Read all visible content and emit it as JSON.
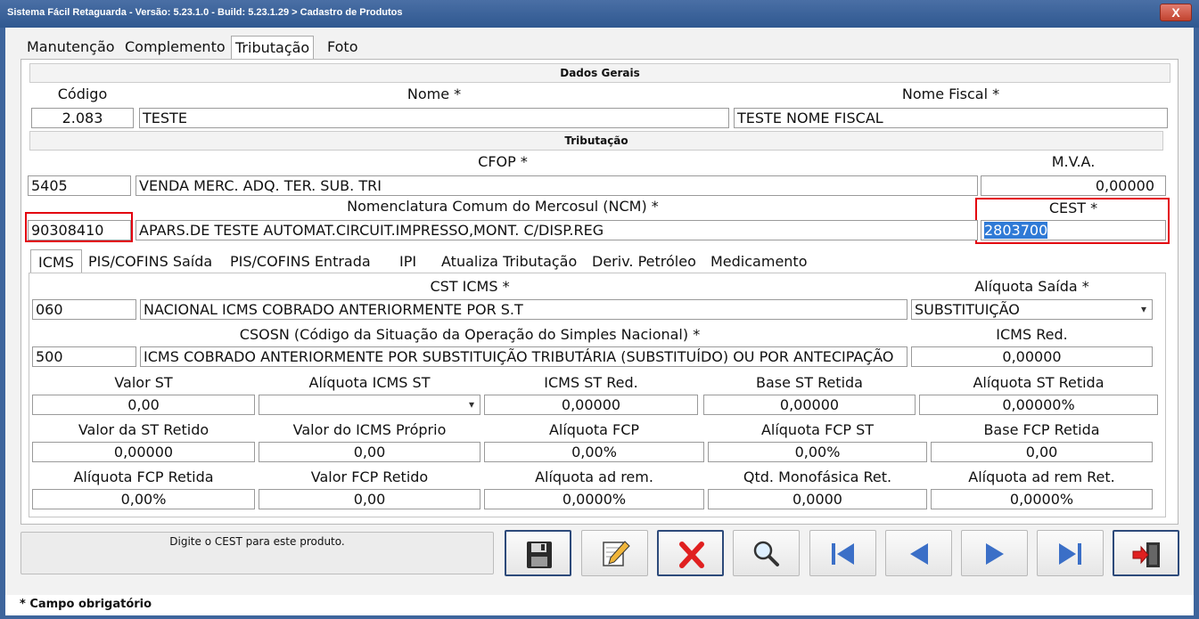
{
  "window": {
    "title": "Sistema Fácil Retaguarda - Versão: 5.23.1.0  - Build: 5.23.1.29 > Cadastro de Produtos",
    "close_label": "X"
  },
  "tabs": [
    {
      "label": "Manutenção",
      "active": false
    },
    {
      "label": "Complemento",
      "active": false
    },
    {
      "label": "Tributação",
      "active": true
    },
    {
      "label": "Foto",
      "active": false
    }
  ],
  "dados_gerais": {
    "header": "Dados Gerais",
    "codigo_label": "Código",
    "codigo_value": "2.083",
    "nome_label": "Nome *",
    "nome_value": "TESTE",
    "nome_fiscal_label": "Nome Fiscal *",
    "nome_fiscal_value": "TESTE NOME FISCAL"
  },
  "tributacao": {
    "header": "Tributação",
    "cfop_label": "CFOP *",
    "cfop_code": "5405",
    "cfop_desc": "VENDA MERC. ADQ. TER. SUB. TRI",
    "mva_label": "M.V.A.",
    "mva_value": "0,00000",
    "ncm_label": "Nomenclatura Comum do Mercosul (NCM) *",
    "ncm_code": "90308410",
    "ncm_desc": "APARS.DE TESTE AUTOMAT.CIRCUIT.IMPRESSO,MONT. C/DISP.REG",
    "cest_label": "CEST *",
    "cest_value": "2803700"
  },
  "subtabs": [
    {
      "label": "ICMS",
      "active": true
    },
    {
      "label": "PIS/COFINS Saída",
      "active": false
    },
    {
      "label": "PIS/COFINS Entrada",
      "active": false
    },
    {
      "label": "IPI",
      "active": false
    },
    {
      "label": "Atualiza Tributação",
      "active": false
    },
    {
      "label": "Deriv. Petróleo",
      "active": false
    },
    {
      "label": "Medicamento",
      "active": false
    }
  ],
  "icms": {
    "cst_label": "CST ICMS *",
    "cst_code": "060",
    "cst_desc": "NACIONAL ICMS COBRADO ANTERIORMENTE POR S.T",
    "aliq_saida_label": "Alíquota Saída *",
    "aliq_saida_value": "SUBSTITUIÇÃO",
    "csosn_label": "CSOSN (Código da Situação da Operação do Simples Nacional) *",
    "csosn_code": "500",
    "csosn_desc": "ICMS COBRADO ANTERIORMENTE POR SUBSTITUIÇÃO TRIBUTÁRIA (SUBSTITUÍDO) OU POR ANTECIPAÇÃO",
    "icms_red_label": "ICMS Red.",
    "icms_red_value": "0,00000",
    "row1": [
      {
        "label": "Valor ST",
        "value": "0,00"
      },
      {
        "label": "Alíquota ICMS ST",
        "value": ""
      },
      {
        "label": "ICMS ST Red.",
        "value": "0,00000"
      },
      {
        "label": "Base ST Retida",
        "value": "0,00000"
      },
      {
        "label": "Alíquota ST Retida",
        "value": "0,00000%"
      }
    ],
    "row2": [
      {
        "label": "Valor da ST Retido",
        "value": "0,00000"
      },
      {
        "label": "Valor do ICMS Próprio",
        "value": "0,00"
      },
      {
        "label": "Alíquota FCP",
        "value": "0,00%"
      },
      {
        "label": "Alíquota FCP ST",
        "value": "0,00%"
      },
      {
        "label": "Base FCP Retida",
        "value": "0,00"
      }
    ],
    "row3": [
      {
        "label": "Alíquota FCP Retida",
        "value": "0,00%"
      },
      {
        "label": "Valor FCP Retido",
        "value": "0,00"
      },
      {
        "label": "Alíquota ad rem.",
        "value": "0,0000%"
      },
      {
        "label": "Qtd. Monofásica Ret.",
        "value": "0,0000"
      },
      {
        "label": "Alíquota ad rem Ret.",
        "value": "0,0000%"
      }
    ]
  },
  "status_message": "Digite o CEST para este produto.",
  "toolbar": {
    "buttons": [
      {
        "icon": "floppy-disk-icon"
      },
      {
        "icon": "edit-pencil-icon"
      },
      {
        "icon": "delete-x-icon"
      },
      {
        "icon": "search-magnifier-icon"
      },
      {
        "icon": "first-record-icon"
      },
      {
        "icon": "previous-record-icon"
      },
      {
        "icon": "next-record-icon"
      },
      {
        "icon": "last-record-icon"
      },
      {
        "icon": "exit-door-icon"
      }
    ]
  },
  "footer": {
    "text": "*  Campo obrigatório"
  },
  "colors": {
    "titlebar": "#2f5890",
    "highlight": "#e3000f",
    "selection": "#2f7ad6",
    "nav_arrow": "#3b6fc7",
    "delete": "#e02020"
  }
}
